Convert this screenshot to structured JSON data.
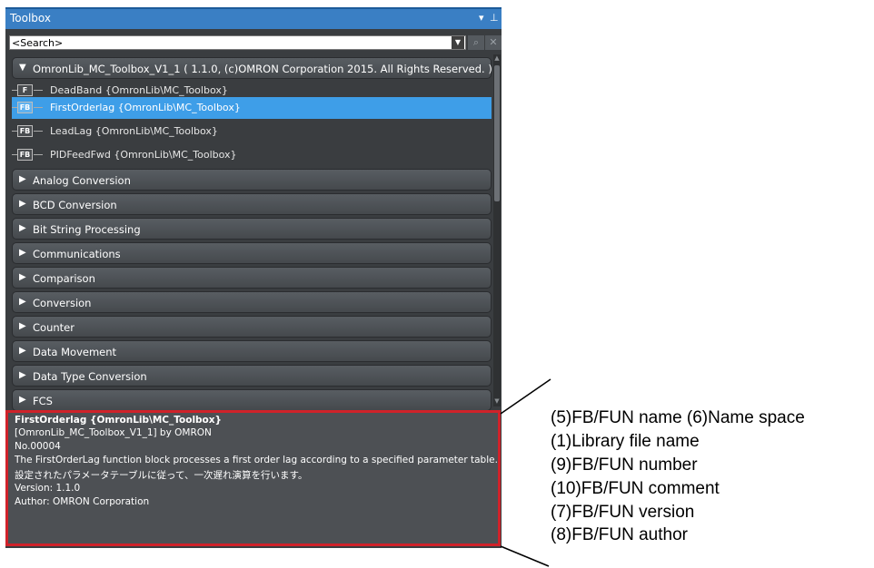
{
  "toolbox": {
    "title": "Toolbox",
    "search_placeholder": "<Search>",
    "pin_glyph": "▾ ₽"
  },
  "library": {
    "header": "OmronLib_MC_Toolbox_V1_1 ( 1.1.0, (c)OMRON Corporation 2015. All Rights Reserved. )",
    "items": [
      {
        "badge": "F",
        "label": "DeadBand {OmronLib\\MC_Toolbox}"
      },
      {
        "badge": "FB",
        "label": "FirstOrderlag {OmronLib\\MC_Toolbox}"
      },
      {
        "badge": "FB",
        "label": "LeadLag {OmronLib\\MC_Toolbox}"
      },
      {
        "badge": "FB",
        "label": "PIDFeedFwd {OmronLib\\MC_Toolbox}"
      }
    ]
  },
  "groups": [
    "Analog Conversion",
    "BCD Conversion",
    "Bit String Processing",
    "Communications",
    "Comparison",
    "Conversion",
    "Counter",
    "Data Movement",
    "Data Type Conversion",
    "FCS"
  ],
  "info": {
    "name": "FirstOrderlag {OmronLib\\MC_Toolbox}",
    "library": "[OmronLib_MC_Toolbox_V1_1] by OMRON",
    "number": "No.00004",
    "comment_en": "The FirstOrderLag function block processes a first order lag according to a specified parameter table.",
    "comment_ja": "設定されたパラメータテーブルに従って、一次遅れ演算を行います。",
    "version": "Version: 1.1.0",
    "author": "Author: OMRON Corporation"
  },
  "callouts": [
    "(5)FB/FUN name (6)Name space",
    "(1)Library file name",
    "(9)FB/FUN number",
    "(10)FB/FUN comment",
    "(7)FB/FUN version",
    "(8)FB/FUN author"
  ],
  "colors": {
    "panel_bg": "#3a3d40",
    "titlebar": "#3a7fc4",
    "selection": "#3e9ee8",
    "highlight_border": "#d0222a"
  }
}
